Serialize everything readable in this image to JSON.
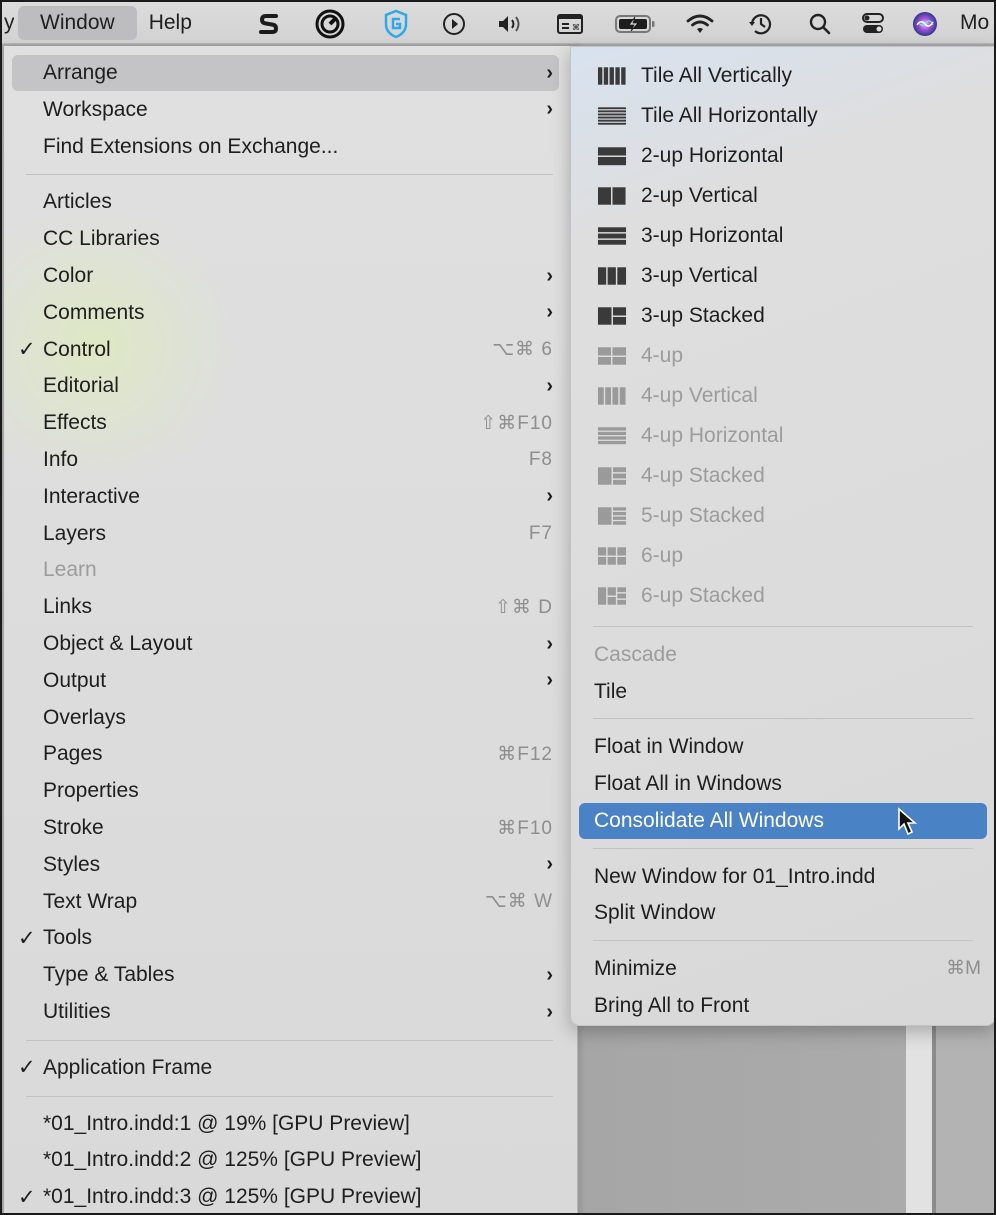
{
  "menubar": {
    "cut_label": "y",
    "items": [
      {
        "label": "Window",
        "active": true
      },
      {
        "label": "Help",
        "active": false
      }
    ],
    "status_icons": [
      "scrivener-s-icon",
      "target-circle-icon",
      "shield-g-icon",
      "play-circle-icon",
      "volume-icon",
      "keyboard-shortcut-icon",
      "battery-charging-icon",
      "wifi-icon",
      "time-machine-icon",
      "spotlight-search-icon",
      "control-center-icon",
      "siri-icon"
    ],
    "trailing_text": "Mo"
  },
  "window_menu": {
    "items": [
      {
        "label": "Arrange",
        "submenu": true,
        "highlighted": true
      },
      {
        "label": "Workspace",
        "submenu": true
      },
      {
        "label": "Find Extensions on Exchange..."
      },
      {
        "separator": true
      },
      {
        "label": "Articles"
      },
      {
        "label": "CC Libraries"
      },
      {
        "label": "Color",
        "submenu": true
      },
      {
        "label": "Comments",
        "submenu": true
      },
      {
        "label": "Control",
        "checked": true,
        "shortcut": "⌥⌘ 6"
      },
      {
        "label": "Editorial",
        "submenu": true
      },
      {
        "label": "Effects",
        "shortcut": "⇧⌘F10"
      },
      {
        "label": "Info",
        "shortcut": "F8"
      },
      {
        "label": "Interactive",
        "submenu": true
      },
      {
        "label": "Layers",
        "shortcut": "F7"
      },
      {
        "label": "Learn",
        "disabled": true
      },
      {
        "label": "Links",
        "shortcut": "⇧⌘ D"
      },
      {
        "label": "Object & Layout",
        "submenu": true
      },
      {
        "label": "Output",
        "submenu": true
      },
      {
        "label": "Overlays"
      },
      {
        "label": "Pages",
        "shortcut": "⌘F12"
      },
      {
        "label": "Properties"
      },
      {
        "label": "Stroke",
        "shortcut": "⌘F10"
      },
      {
        "label": "Styles",
        "submenu": true
      },
      {
        "label": "Text Wrap",
        "shortcut": "⌥⌘ W"
      },
      {
        "label": "Tools",
        "checked": true
      },
      {
        "label": "Type & Tables",
        "submenu": true
      },
      {
        "label": "Utilities",
        "submenu": true
      },
      {
        "separator": true
      },
      {
        "label": "Application Frame",
        "checked": true
      },
      {
        "separator": true
      },
      {
        "label": "*01_Intro.indd:1 @ 19% [GPU Preview]"
      },
      {
        "label": "*01_Intro.indd:2 @ 125% [GPU Preview]"
      },
      {
        "label": "*01_Intro.indd:3 @ 125% [GPU Preview]",
        "checked": true
      }
    ]
  },
  "arrange_submenu": {
    "items": [
      {
        "label": "Tile All Vertically",
        "icon": "tile-all-vertically-icon"
      },
      {
        "label": "Tile All Horizontally",
        "icon": "tile-all-horizontally-icon"
      },
      {
        "label": "2-up Horizontal",
        "icon": "2up-horizontal-icon"
      },
      {
        "label": "2-up Vertical",
        "icon": "2up-vertical-icon"
      },
      {
        "label": "3-up Horizontal",
        "icon": "3up-horizontal-icon"
      },
      {
        "label": "3-up Vertical",
        "icon": "3up-vertical-icon"
      },
      {
        "label": "3-up Stacked",
        "icon": "3up-stacked-icon"
      },
      {
        "label": "4-up",
        "icon": "4up-icon",
        "disabled": true
      },
      {
        "label": "4-up Vertical",
        "icon": "4up-vertical-icon",
        "disabled": true
      },
      {
        "label": "4-up Horizontal",
        "icon": "4up-horizontal-icon",
        "disabled": true
      },
      {
        "label": "4-up Stacked",
        "icon": "4up-stacked-icon",
        "disabled": true
      },
      {
        "label": "5-up Stacked",
        "icon": "5up-stacked-icon",
        "disabled": true
      },
      {
        "label": "6-up",
        "icon": "6up-icon",
        "disabled": true
      },
      {
        "label": "6-up Stacked",
        "icon": "6up-stacked-icon",
        "disabled": true
      },
      {
        "separator": true
      },
      {
        "label": "Cascade",
        "disabled": true
      },
      {
        "label": "Tile"
      },
      {
        "separator": true
      },
      {
        "label": "Float in Window"
      },
      {
        "label": "Float All in Windows"
      },
      {
        "label": "Consolidate All Windows",
        "selected": true
      },
      {
        "separator": true
      },
      {
        "label": "New Window for 01_Intro.indd"
      },
      {
        "label": "Split Window"
      },
      {
        "separator": true
      },
      {
        "label": "Minimize",
        "shortcut": "⌘M"
      },
      {
        "label": "Bring All to Front"
      }
    ]
  },
  "colors": {
    "selection": "#4a82c6",
    "menu_bg": "#dcdcdc",
    "disabled_text": "#9c9c9c",
    "shortcut_text": "#8e8e8e"
  }
}
